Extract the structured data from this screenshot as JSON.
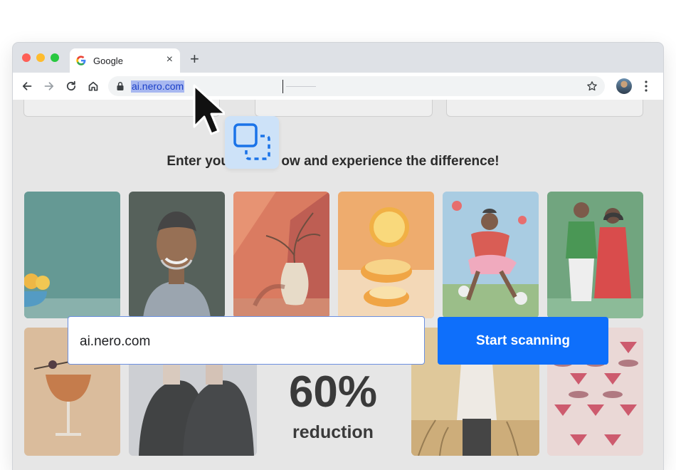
{
  "browser": {
    "tab_title": "Google",
    "tab_close": "×",
    "new_tab": "+",
    "url": "ai.nero.com"
  },
  "page": {
    "headline": "Enter your",
    "headline_rest": "ow and experience the difference!",
    "stat_value": "60%",
    "stat_label": "reduction"
  },
  "scan": {
    "input_value": "ai.nero.com",
    "button_label": "Start scanning"
  },
  "icons": {
    "back": "arrow-left-icon",
    "forward": "arrow-right-icon",
    "reload": "reload-icon",
    "home": "home-icon",
    "lock": "lock-icon",
    "star": "star-icon",
    "menu": "kebab-menu-icon",
    "selector": "region-select-icon",
    "cursor": "mouse-pointer-icon"
  },
  "colors": {
    "accent": "#0e6ffb",
    "selection": "#a8b8f0",
    "badge": "#cde2f8"
  }
}
